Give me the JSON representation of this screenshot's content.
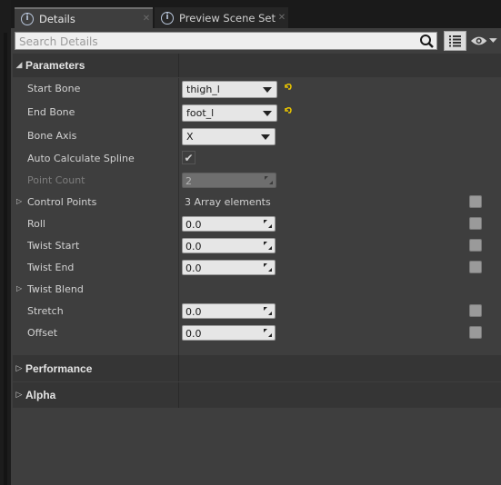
{
  "tabs": [
    {
      "label": "Details",
      "icon": "details-info-icon",
      "active": true
    },
    {
      "label": "Preview Scene Sett",
      "icon": "details-info-icon",
      "active": false
    }
  ],
  "search": {
    "placeholder": "Search Details"
  },
  "sections": {
    "parameters": "Parameters",
    "performance": "Performance",
    "alpha": "Alpha"
  },
  "properties": {
    "start_bone": {
      "label": "Start Bone",
      "value": "thigh_l"
    },
    "end_bone": {
      "label": "End Bone",
      "value": "foot_l"
    },
    "bone_axis": {
      "label": "Bone Axis",
      "value": "X"
    },
    "auto_calc": {
      "label": "Auto Calculate Spline",
      "checked": true
    },
    "point_count": {
      "label": "Point Count",
      "value": "2"
    },
    "control_points": {
      "label": "Control Points",
      "value": "3 Array elements"
    },
    "roll": {
      "label": "Roll",
      "value": "0.0"
    },
    "twist_start": {
      "label": "Twist Start",
      "value": "0.0"
    },
    "twist_end": {
      "label": "Twist End",
      "value": "0.0"
    },
    "twist_blend": {
      "label": "Twist Blend"
    },
    "stretch": {
      "label": "Stretch",
      "value": "0.0"
    },
    "offset": {
      "label": "Offset",
      "value": "0.0"
    }
  },
  "colors": {
    "panel": "#3e3e3e",
    "section_header": "#353535",
    "reset_arrow": "#e8c400"
  }
}
